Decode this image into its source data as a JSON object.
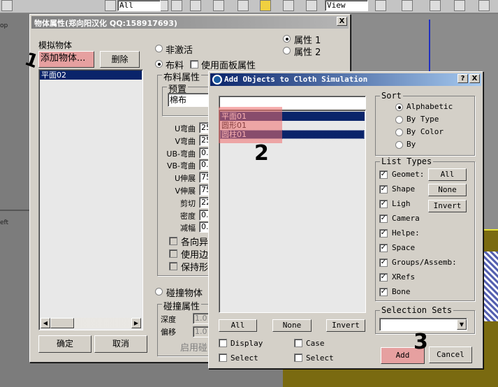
{
  "toolbar": {
    "filter_value": "All",
    "view_value": "View"
  },
  "viewports": {
    "left_label_top": "op",
    "left_label_bottom": "eft"
  },
  "props_dialog": {
    "title": "物体属性(郑向阳汉化 QQ:158917693)",
    "close": "X",
    "sim_objects_label": "模拟物体",
    "add_button": "添加物体...",
    "delete_button": "删除",
    "objects": [
      {
        "name": "平面02",
        "selected": true
      }
    ],
    "ok_button": "确定",
    "cancel_button": "取消",
    "inactive_label": "非激活",
    "cloth_label": "布料",
    "use_panel_label": "使用面板属性",
    "prop1_label": "属性 1",
    "prop2_label": "属性 2",
    "cloth_group": "布料属性",
    "preset_group": "预置",
    "preset_value": "棉布",
    "params": [
      {
        "label": "U弯曲",
        "value": "25"
      },
      {
        "label": "V弯曲",
        "value": "25"
      },
      {
        "label": "UB-弯曲",
        "value": "0."
      },
      {
        "label": "VB-弯曲",
        "value": "0."
      },
      {
        "label": "U伸展",
        "value": "75"
      },
      {
        "label": "V伸展",
        "value": "75"
      },
      {
        "label": "剪切",
        "value": "22"
      },
      {
        "label": "密度",
        "value": "0."
      },
      {
        "label": "减幅",
        "value": "0."
      }
    ],
    "checks": [
      "各向异",
      "使用边",
      "保持形"
    ],
    "collision_label": "碰撞物体",
    "collision_group": "碰撞属性",
    "depth_label": "深度",
    "depth_value": "1.0",
    "offset_label": "偏移",
    "offset_value": "1.0",
    "enable_label": "启用碰"
  },
  "add_dialog": {
    "title": "Add Objects to Cloth Simulation",
    "help": "?",
    "close": "X",
    "search_value": "",
    "items": [
      {
        "name": "平面01",
        "selected": true
      },
      {
        "name": "圆形01",
        "selected": false
      },
      {
        "name": "圆柱01",
        "selected": true
      }
    ],
    "all_button": "All",
    "none_button": "None",
    "invert_button": "Invert",
    "display_label": "Display",
    "case_label": "Case",
    "select_label": "Select",
    "select2_label": "Select",
    "sort_group": "Sort",
    "sort_options": [
      "Alphabetic",
      "By Type",
      "By Color",
      "By"
    ],
    "sort_selected": "Alphabetic",
    "list_types_group": "List Types",
    "types": [
      "Geomet:",
      "Shape",
      "Ligh",
      "Camera",
      "Helpe:",
      "Space",
      "Groups/Assemb:",
      "XRefs",
      "Bone"
    ],
    "types_all": "All",
    "types_none": "None",
    "types_invert": "Invert",
    "selection_sets_group": "Selection Sets",
    "selection_sets_value": "",
    "add_button": "Add",
    "cancel_button": "Cancel"
  },
  "annotations": {
    "step1": "1",
    "step2": "2",
    "step3": "3"
  },
  "colors": {
    "highlight": "#f06e6e",
    "selection": "#0a246a",
    "title_active": "#0a246a"
  }
}
